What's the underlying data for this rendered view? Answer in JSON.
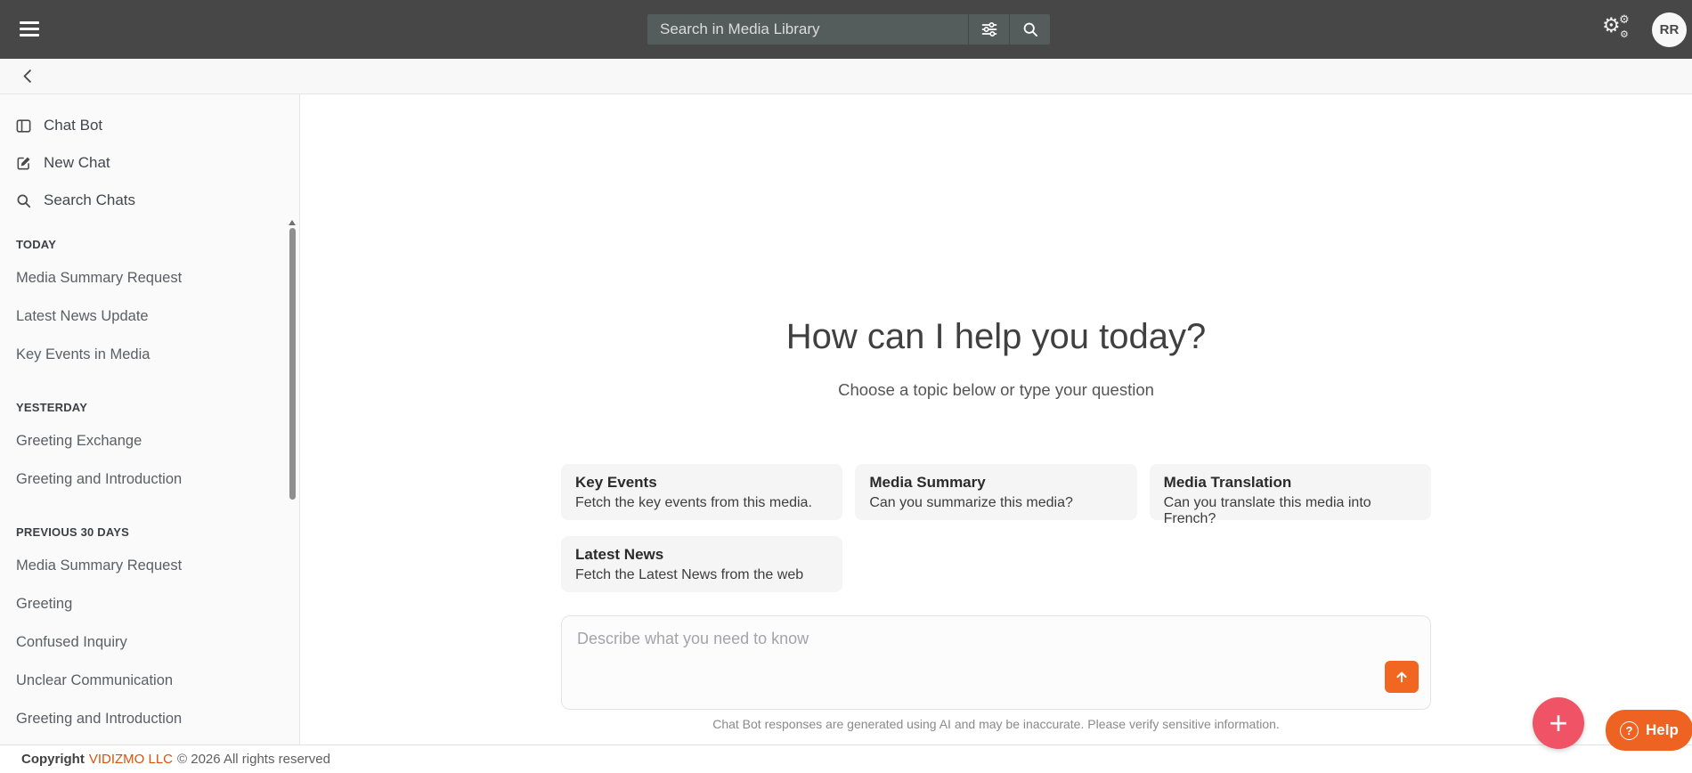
{
  "topbar": {
    "search": {
      "placeholder": "Search in Media Library"
    },
    "avatar_initials": "RR"
  },
  "sidebar": {
    "nav": [
      {
        "label": "Chat Bot"
      },
      {
        "label": "New Chat"
      },
      {
        "label": "Search Chats"
      }
    ],
    "sections": [
      {
        "title": "TODAY",
        "items": [
          "Media Summary Request",
          "Latest News Update",
          "Key Events in Media"
        ]
      },
      {
        "title": "YESTERDAY",
        "items": [
          "Greeting Exchange",
          "Greeting and Introduction"
        ]
      },
      {
        "title": "PREVIOUS 30 DAYS",
        "items": [
          "Media Summary Request",
          "Greeting",
          "Confused Inquiry",
          "Unclear Communication",
          "Greeting and Introduction"
        ]
      }
    ]
  },
  "main": {
    "title": "How can I help you today?",
    "subtitle": "Choose a topic below or type your question",
    "cards": [
      {
        "title": "Key Events",
        "desc": "Fetch the key events from this media."
      },
      {
        "title": "Media Summary",
        "desc": "Can you summarize this media?"
      },
      {
        "title": "Media Translation",
        "desc": "Can you translate this media into French?"
      },
      {
        "title": "Latest News",
        "desc": "Fetch the Latest News from the web"
      }
    ],
    "composer": {
      "placeholder": "Describe what you need to know"
    },
    "disclaimer": "Chat Bot responses are generated using AI and may be inaccurate. Please verify sensitive information."
  },
  "footer": {
    "copyright_label": "Copyright",
    "company": "VIDIZMO LLC",
    "rights": "© 2026 All rights reserved"
  },
  "floating": {
    "help_label": "Help",
    "help_icon_glyph": "?",
    "add_icon_glyph": "+"
  },
  "icons": {
    "gear_glyph": "⚙",
    "menu": "hamburger-three-bars",
    "filter": "sliders",
    "search": "magnifier",
    "settings": "triple-gears",
    "back": "chevron-left",
    "chat_bot": "side-panel",
    "new_chat": "compose-pencil",
    "search_chats": "magnifier",
    "send": "arrow-up"
  },
  "colors": {
    "topbar_bg": "#474747",
    "search_field_bg": "#555c5c",
    "accent_orange": "#f16722",
    "help_orange": "#ef6322",
    "fab_pink": "#ef5365",
    "link_orange": "#d95209",
    "sidebar_bg": "#fafafa",
    "card_bg": "#f5f5f5"
  }
}
